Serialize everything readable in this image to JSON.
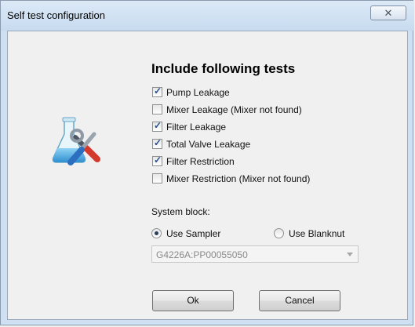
{
  "window": {
    "title": "Self test configuration",
    "close_glyph": "✕"
  },
  "icon": "test-tools-icon",
  "heading": "Include following tests",
  "tests": [
    {
      "label": "Pump Leakage",
      "checked": true
    },
    {
      "label": "Mixer Leakage (Mixer not found)",
      "checked": false
    },
    {
      "label": "Filter Leakage",
      "checked": true
    },
    {
      "label": "Total Valve Leakage",
      "checked": true
    },
    {
      "label": "Filter Restriction",
      "checked": true
    },
    {
      "label": "Mixer Restriction (Mixer not found)",
      "checked": false
    }
  ],
  "system_block": {
    "label": "System block:",
    "options": [
      {
        "label": "Use Sampler",
        "selected": true
      },
      {
        "label": "Use Blanknut",
        "selected": false
      }
    ],
    "dropdown_value": "G4226A:PP00055050"
  },
  "buttons": {
    "ok": "Ok",
    "cancel": "Cancel"
  }
}
